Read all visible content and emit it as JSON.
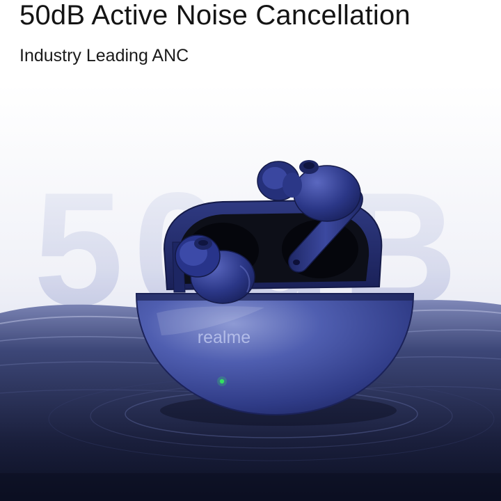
{
  "headline": "50dB Active Noise Cancellation",
  "subheadline": "Industry Leading ANC",
  "hero": {
    "background_numeral": "50dB",
    "case_brand": "realme",
    "colors": {
      "sky_top": "#ffffff",
      "sky_bottom": "#c9cde6",
      "water_mid": "#3d4778",
      "water_deep": "#0b0f22",
      "case_blue": "#3b4a9c",
      "case_highlight": "#8e9ad4",
      "case_interior": "#0d0f18",
      "earbud_blue": "#2b3787",
      "led": "#33e060"
    },
    "icons": {
      "earbud_left": "earbud-icon",
      "earbud_right": "earbud-icon",
      "charging_case": "charging-case-icon",
      "status_led": "led-indicator-icon"
    }
  }
}
